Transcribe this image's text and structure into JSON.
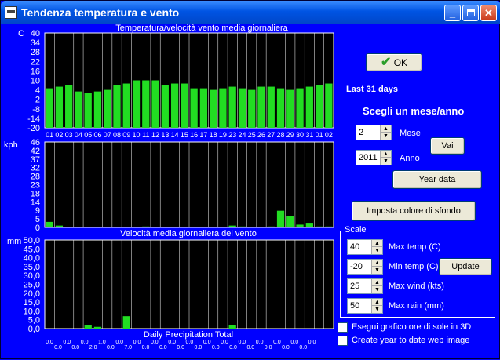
{
  "window": {
    "title": "Tendenza temperatura e vento"
  },
  "colors": {
    "background": "#0000ff",
    "plot_bg": "#000000",
    "bar": "#22dd22",
    "grid": "#ffffff"
  },
  "titlebar_buttons": [
    {
      "name": "minimize",
      "icon": "minimize-icon",
      "glyph": "_"
    },
    {
      "name": "maximize",
      "icon": "maximize-icon",
      "glyph": ""
    },
    {
      "name": "close",
      "icon": "close-icon",
      "glyph": "✕"
    }
  ],
  "right_panel": {
    "ok_label": "OK",
    "period_label": "Last 31 days",
    "choose_label": "Scegli un mese/anno",
    "month_value": "2",
    "month_label": "Mese",
    "year_value": "2011",
    "year_label": "Anno",
    "go_label": "Vai",
    "year_data_label": "Year data",
    "bg_color_label": "Imposta colore di sfondo"
  },
  "scale": {
    "title": "Scale",
    "max_temp_value": "40",
    "max_temp_label": "Max temp (C)",
    "min_temp_value": "-20",
    "min_temp_label": "Min temp (C)",
    "max_wind_value": "25",
    "max_wind_label": "Max wind (kts)",
    "max_rain_value": "50",
    "max_rain_label": "Max rain (mm)",
    "update_label": "Update"
  },
  "options": {
    "sun_3d_label": "Esegui grafico ore di sole in 3D",
    "sun_3d_checked": false,
    "web_image_label": "Create year to date web image",
    "web_image_checked": false
  },
  "chart_data": [
    {
      "type": "bar",
      "title": "Temperatura/velocità vento media giornaliera",
      "ylabel": "C",
      "ylim": [
        -20,
        40
      ],
      "yticks": [
        40,
        34,
        28,
        22,
        16,
        10,
        4,
        -2,
        -8,
        -14,
        -20
      ],
      "categories": [
        "01",
        "02",
        "03",
        "04",
        "05",
        "06",
        "07",
        "08",
        "09",
        "10",
        "11",
        "12",
        "13",
        "14",
        "15",
        "16",
        "17",
        "18",
        "19",
        "23",
        "24",
        "25",
        "26",
        "27",
        "28",
        "29",
        "30",
        "31",
        "01",
        "02"
      ],
      "values": [
        5,
        6,
        7,
        3,
        2,
        3,
        4,
        7,
        8,
        10,
        10,
        10,
        7,
        8,
        8,
        5,
        5,
        4,
        5,
        6,
        5,
        4,
        6,
        6,
        5,
        4,
        5,
        6,
        7,
        8
      ]
    },
    {
      "type": "bar",
      "ylabel": "kph",
      "ylim": [
        0,
        46
      ],
      "yticks": [
        46,
        42,
        37,
        32,
        28,
        23,
        18,
        14,
        9,
        5,
        0
      ],
      "values": [
        3,
        1,
        0,
        0,
        0,
        0,
        0,
        0,
        0,
        0,
        0.5,
        0,
        0,
        0,
        0,
        0,
        0,
        0,
        0,
        1,
        0.5,
        0,
        0,
        0.5,
        9,
        6,
        1.5,
        2.5,
        0.5,
        0.5
      ]
    },
    {
      "type": "bar",
      "title": "Velocità media giornaliera del vento",
      "ylabel": "mm",
      "ylim": [
        0,
        50
      ],
      "yticks": [
        "50,0",
        "45,0",
        "40,0",
        "35,0",
        "30,0",
        "25,0",
        "20,0",
        "15,0",
        "10,0",
        "5,0",
        "0,0"
      ],
      "values": [
        0,
        0,
        0,
        0,
        2,
        1,
        0,
        0,
        7,
        0,
        0,
        0,
        0,
        0,
        0,
        0,
        0,
        0,
        0,
        2,
        0,
        0,
        0,
        0,
        0,
        0,
        0,
        0,
        0,
        0
      ],
      "footer": "Daily Precipitation Total",
      "totals_row1": [
        "0.0",
        "0.0",
        "0.0",
        "1.0",
        "0.0",
        "0.0",
        "0.0",
        "0.0",
        "0.0",
        "0.0",
        "0.0",
        "0.0",
        "0.0",
        "0.0",
        "0.0",
        "0.0"
      ],
      "totals_row2": [
        "0.0",
        "0.0",
        "2.0",
        "0.0",
        "7.0",
        "0.0",
        "0.0",
        "0.0",
        "0.0",
        "0.0",
        "0.0",
        "0.0",
        "0.0",
        "0.0",
        "0.0"
      ]
    }
  ]
}
